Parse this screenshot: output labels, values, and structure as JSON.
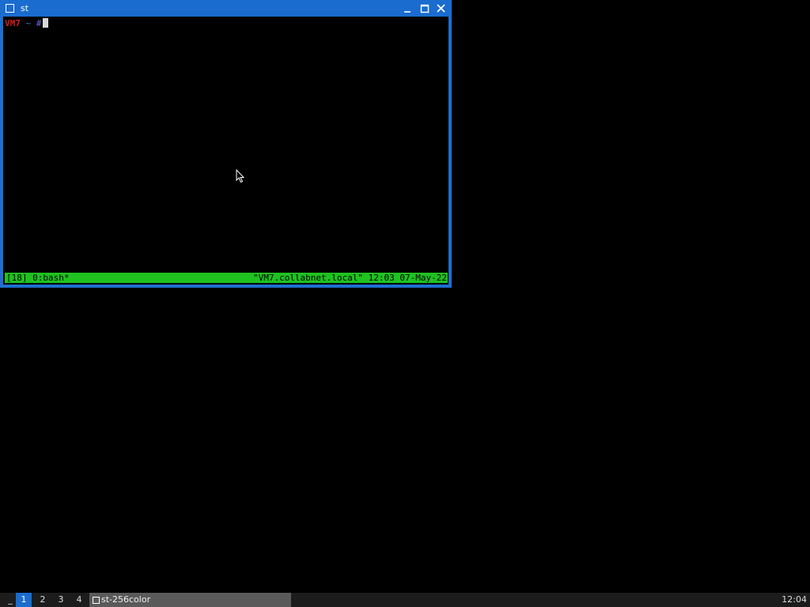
{
  "window": {
    "title": "st",
    "icons": {
      "app": "window-icon",
      "minimize": "minimize-icon",
      "maximize": "maximize-icon",
      "close": "close-icon"
    },
    "colors": {
      "titlebar": "#1a6ccf"
    }
  },
  "terminal": {
    "prompt": {
      "host": "VM7",
      "path": "~",
      "symbol": "#"
    },
    "status_bar": {
      "left": "[18] 0:bash*",
      "right": "\"VM7.collabnet.local\" 12:03 07-May-22",
      "color": "#1fc21f"
    }
  },
  "taskbar": {
    "menu_label": "_",
    "workspaces": [
      "1",
      "2",
      "3",
      "4"
    ],
    "active_workspace": "1",
    "task": {
      "label": "st-256color",
      "icon": "window-icon"
    },
    "clock": "12:04"
  }
}
